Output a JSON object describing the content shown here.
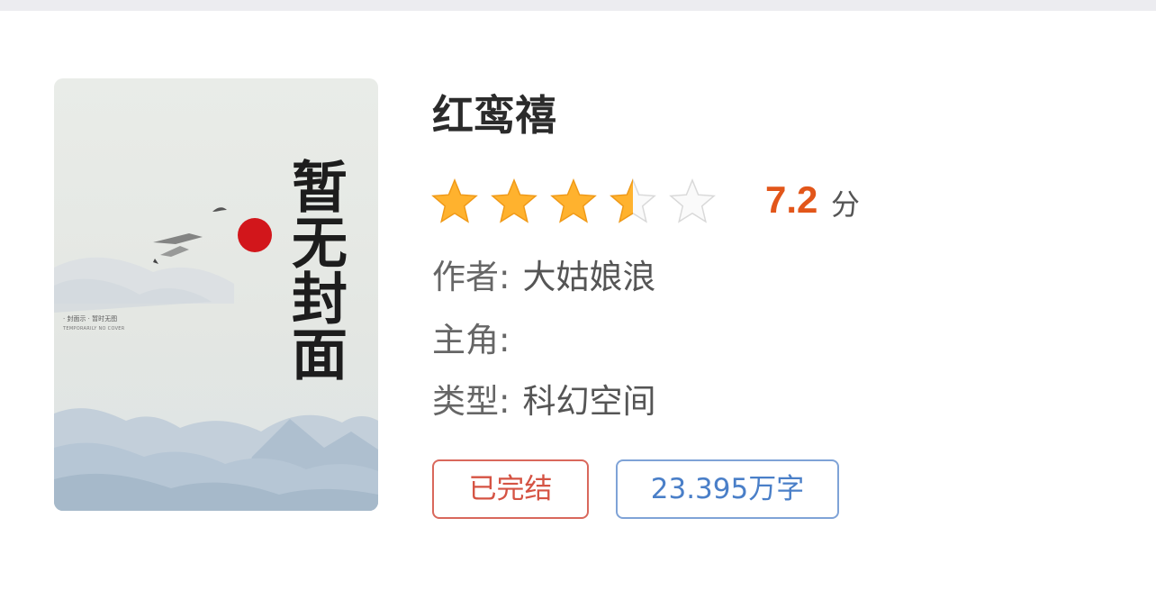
{
  "book": {
    "title": "红鸾禧",
    "cover": {
      "title_text": "暂无封面",
      "small_line1": "· 封面示 · 暂时无图",
      "small_line2": "TEMPORARILY NO COVER"
    },
    "rating": {
      "stars": 3.5,
      "max_stars": 5,
      "score": "7.2",
      "unit": "分"
    },
    "author": {
      "label": "作者:",
      "value": "大姑娘浪"
    },
    "protagonist": {
      "label": "主角:",
      "value": ""
    },
    "genre": {
      "label": "类型:",
      "value": "科幻空间"
    },
    "tags": {
      "status": "已完结",
      "word_count": "23.395万字"
    }
  },
  "colors": {
    "score": "#e2561a",
    "status_tag": "#d55343",
    "words_tag": "#4a7fc8",
    "star_fill": "#ffb22e",
    "star_empty": "#d9d9d9"
  }
}
